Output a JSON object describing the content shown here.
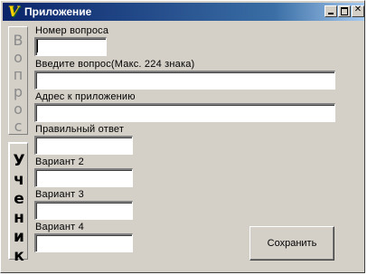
{
  "window": {
    "title": "Приложение",
    "icon_glyph": "V"
  },
  "side_tabs": {
    "question_tab": "Вопрос",
    "student_tab": "Ученик"
  },
  "form": {
    "question_number_label": "Номер вопроса",
    "question_number_value": "",
    "question_text_label": "Введите вопрос(Макс. 224 знака)",
    "question_text_value": "",
    "attachment_label": "Адрес к приложению",
    "attachment_value": "",
    "correct_answer_label": "Правильный ответ",
    "correct_answer_value": "",
    "variant2_label": "Вариант 2",
    "variant2_value": "",
    "variant3_label": "Вариант 3",
    "variant3_value": "",
    "variant4_label": "Вариант 4",
    "variant4_value": ""
  },
  "buttons": {
    "save_label": "Сохранить"
  }
}
